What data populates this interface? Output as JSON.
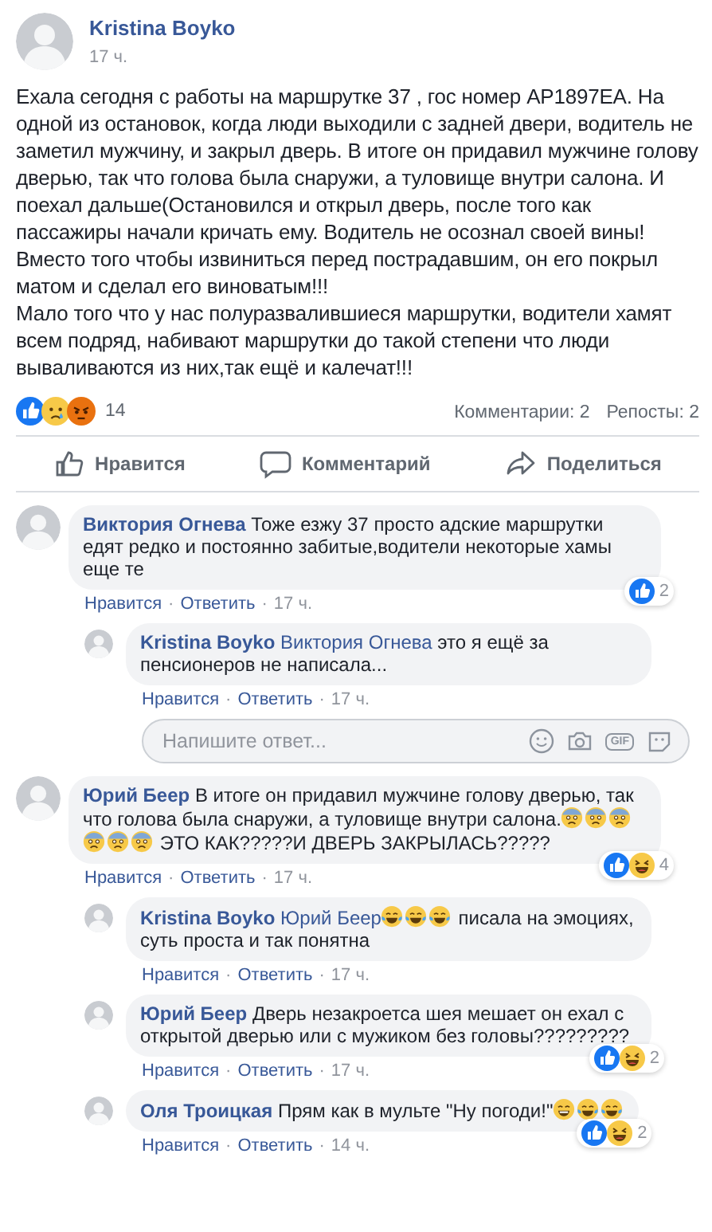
{
  "post": {
    "author": "Kristina Boyko",
    "time": "17 ч.",
    "paragraphs": [
      "Ехала сегодня с работы на маршрутке 37 , гос номер AP1897EA. На одной из остановок, когда люди выходили с задней двери, водитель не заметил мужчину, и закрыл дверь. В итоге он придавил мужчине голову дверью, так что голова была снаружи, а туловище внутри салона. И поехал дальше(Остановился и открыл дверь, после того как пассажиры начали кричать ему. Водитель не осознал своей вины! Вместо того чтобы извиниться перед пострадавшим, он его покрыл матом и сделал его виноватым!!!",
      "Мало того что у нас полуразвалившиеся маршрутки, водители хамят всем подряд, набивают маршрутки до такой степени что люди вываливаются из них,так ещё и калечат!!!"
    ],
    "reactions": [
      {
        "kind": "like"
      },
      {
        "kind": "sad"
      },
      {
        "kind": "angry"
      }
    ],
    "reaction_count": "14",
    "comments_count": "Комментарии: 2",
    "shares_count": "Репосты: 2"
  },
  "actions": [
    {
      "kind": "like",
      "label": "Нравится"
    },
    {
      "kind": "comment",
      "label": "Комментарий"
    },
    {
      "kind": "share",
      "label": "Поделиться"
    }
  ],
  "comments": [
    {
      "author": "Виктория Огнева",
      "parts": [
        {
          "kind": "text",
          "text": "Тоже езжу 37 просто адские маршрутки едят редко и постоянно забитые,водители некоторые хамы еще те"
        }
      ],
      "reactions": [
        {
          "kind": "like"
        }
      ],
      "reaction_count": "2",
      "links": [
        {
          "kind": "link",
          "text": "Нравится"
        },
        {
          "kind": "dot",
          "text": "·"
        },
        {
          "kind": "link",
          "text": "Ответить"
        },
        {
          "kind": "dot",
          "text": "·"
        },
        {
          "kind": "time",
          "text": "17 ч."
        }
      ],
      "children": [
        {
          "author": "Kristina Boyko",
          "parts": [
            {
              "kind": "mention",
              "text": "Виктория Огнева"
            },
            {
              "kind": "text",
              "text": "это я ещё за пенсионеров не написала..."
            }
          ],
          "links": [
            {
              "kind": "link",
              "text": "Нравится"
            },
            {
              "kind": "dot",
              "text": "·"
            },
            {
              "kind": "link",
              "text": "Ответить"
            },
            {
              "kind": "dot",
              "text": "·"
            },
            {
              "kind": "time",
              "text": "17 ч."
            }
          ]
        }
      ],
      "reply_box": {
        "placeholder": "Напишите ответ...",
        "gif_label": "GIF"
      }
    },
    {
      "author": "Юрий Беер",
      "parts": [
        {
          "kind": "text",
          "text": "В итоге он придавил мужчине голову дверью, так что голова была снаружи, а туловище внутри салона."
        },
        {
          "kind": "fearful"
        },
        {
          "kind": "fearful"
        },
        {
          "kind": "fearful"
        },
        {
          "kind": "fearful"
        },
        {
          "kind": "fearful"
        },
        {
          "kind": "fearful"
        },
        {
          "kind": "text",
          "text": "ЭТО КАК?????И ДВЕРЬ ЗАКРЫЛАСЬ?????"
        }
      ],
      "reactions": [
        {
          "kind": "like"
        },
        {
          "kind": "haha"
        }
      ],
      "reaction_count": "4",
      "links": [
        {
          "kind": "link",
          "text": "Нравится"
        },
        {
          "kind": "dot",
          "text": "·"
        },
        {
          "kind": "link",
          "text": "Ответить"
        },
        {
          "kind": "dot",
          "text": "·"
        },
        {
          "kind": "time",
          "text": "17 ч."
        }
      ],
      "children": [
        {
          "author": "Kristina Boyko",
          "parts": [
            {
              "kind": "mention",
              "text": "Юрий Беер"
            },
            {
              "kind": "joy"
            },
            {
              "kind": "joy"
            },
            {
              "kind": "joy"
            },
            {
              "kind": "text",
              "text": "писала на эмоциях, суть проста и так понятна"
            }
          ],
          "links": [
            {
              "kind": "link",
              "text": "Нравится"
            },
            {
              "kind": "dot",
              "text": "·"
            },
            {
              "kind": "link",
              "text": "Ответить"
            },
            {
              "kind": "dot",
              "text": "·"
            },
            {
              "kind": "time",
              "text": "17 ч."
            }
          ]
        },
        {
          "author": "Юрий Беер",
          "parts": [
            {
              "kind": "text",
              "text": "Дверь незакроетса шея мешает он ехал с открытой дверью или с мужиком без головы?????????"
            }
          ],
          "reactions": [
            {
              "kind": "like"
            },
            {
              "kind": "haha"
            }
          ],
          "reaction_count": "2",
          "links": [
            {
              "kind": "link",
              "text": "Нравится"
            },
            {
              "kind": "dot",
              "text": "·"
            },
            {
              "kind": "link",
              "text": "Ответить"
            },
            {
              "kind": "dot",
              "text": "·"
            },
            {
              "kind": "time",
              "text": "17 ч."
            }
          ]
        },
        {
          "author": "Оля Троицкая",
          "parts": [
            {
              "kind": "text",
              "text": "Прям как в мульте \"Ну погоди!\""
            },
            {
              "kind": "grin"
            },
            {
              "kind": "joy"
            },
            {
              "kind": "joy"
            }
          ],
          "reactions": [
            {
              "kind": "like"
            },
            {
              "kind": "haha"
            }
          ],
          "reaction_count": "2",
          "links": [
            {
              "kind": "link",
              "text": "Нравится"
            },
            {
              "kind": "dot",
              "text": "·"
            },
            {
              "kind": "link",
              "text": "Ответить"
            },
            {
              "kind": "dot",
              "text": "·"
            },
            {
              "kind": "time",
              "text": "14 ч."
            }
          ]
        }
      ]
    }
  ]
}
